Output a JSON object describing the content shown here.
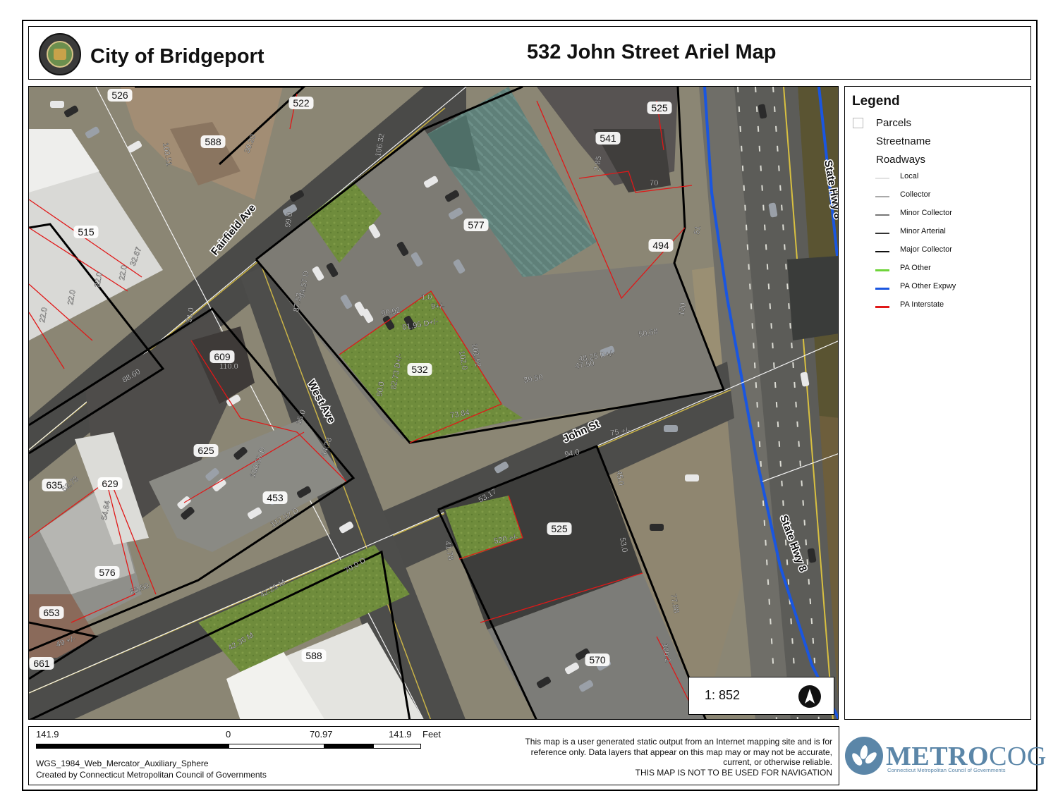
{
  "header": {
    "city_title": "City of Bridgeport",
    "map_title": "532 John Street Ariel Map"
  },
  "legend": {
    "title": "Legend",
    "layers": [
      "Parcels",
      "Streetname",
      "Roadways"
    ],
    "roadways": [
      {
        "label": "Local",
        "color": "#e2e2e2"
      },
      {
        "label": "Collector",
        "color": "#a9a9a9"
      },
      {
        "label": "Minor Collector",
        "color": "#777777"
      },
      {
        "label": "Minor Arterial",
        "color": "#333333"
      },
      {
        "label": "Major Collector",
        "color": "#111111"
      },
      {
        "label": "PA Other",
        "color": "#6fd43a"
      },
      {
        "label": "PA Other Expwy",
        "color": "#1a56e0"
      },
      {
        "label": "PA Interstate",
        "color": "#e01818"
      }
    ]
  },
  "map": {
    "scale_ratio": "1: 852",
    "north_arrow_icon": "north-arrow-icon",
    "streets": [
      "Fairfield Ave",
      "West Ave",
      "John St",
      "State Hwy 8",
      "State Hwy 8"
    ],
    "parcels": [
      "526",
      "522",
      "588",
      "525",
      "541",
      "515",
      "577",
      "494",
      "609",
      "532",
      "625",
      "635",
      "629",
      "453",
      "525",
      "576",
      "653",
      "570",
      "588",
      "661"
    ],
    "dimensions": [
      "100.51",
      "30.20",
      "32.67",
      "22.0",
      "22.0",
      "22.0",
      "22.0",
      "106.32",
      "99.0",
      "94.57 D",
      "87.53",
      "90.92",
      "81.95 D+/-",
      "1.0",
      "9+/-",
      "101.92",
      "102.0",
      "82.73 D+/-",
      "90.0",
      "73.84",
      "39.50",
      "48.25 D+/-",
      "47.50",
      "50.68",
      "120",
      "51",
      "2.85",
      "70",
      "31.0",
      "110.0",
      "88.60",
      "15.0",
      "44.28",
      "100.50 D",
      "112.92 D",
      "94.0",
      "75 +/-",
      "45.0",
      "53.17",
      "41.78",
      "520 +/-",
      "53.0",
      "77.88",
      "180.2",
      "62.78",
      "54.64",
      "88.50",
      "49 +/-",
      "42.25 M",
      "42.36 M",
      "70.0 D"
    ]
  },
  "scale_bar": {
    "labels": [
      "141.9",
      "0",
      "70.97",
      "141.9"
    ],
    "unit": "Feet",
    "projection": "WGS_1984_Web_Mercator_Auxiliary_Sphere",
    "credit": "Created by Connecticut Metropolitan Council of Governments"
  },
  "disclaimer": {
    "text": "This map is a user generated static output from an Internet mapping site and is for reference only. Data layers that appear on this map may or may not be accurate, current, or otherwise reliable.",
    "warning": "THIS MAP IS NOT TO BE USED FOR NAVIGATION"
  },
  "logo": {
    "name_a": "METRO",
    "name_b": "COG",
    "subtitle": "Connecticut Metropolitan Council of Governments"
  }
}
